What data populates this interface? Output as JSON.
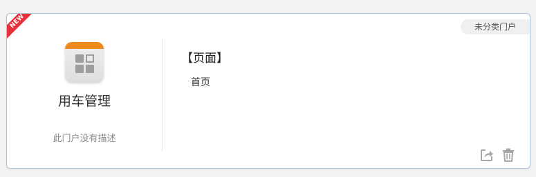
{
  "card": {
    "badge": "NEW",
    "category": "未分类门户",
    "app": {
      "name": "用车管理",
      "description": "此门户没有描述",
      "icon": "grid-app-icon"
    },
    "section": {
      "title": "【页面】",
      "pages": [
        "首页"
      ]
    },
    "actions": [
      {
        "icon": "share-icon"
      },
      {
        "icon": "trash-icon"
      }
    ]
  },
  "colors": {
    "ribbon": "#e8303a",
    "icon_top": "#f08a1c",
    "card_border": "#aec3de"
  }
}
